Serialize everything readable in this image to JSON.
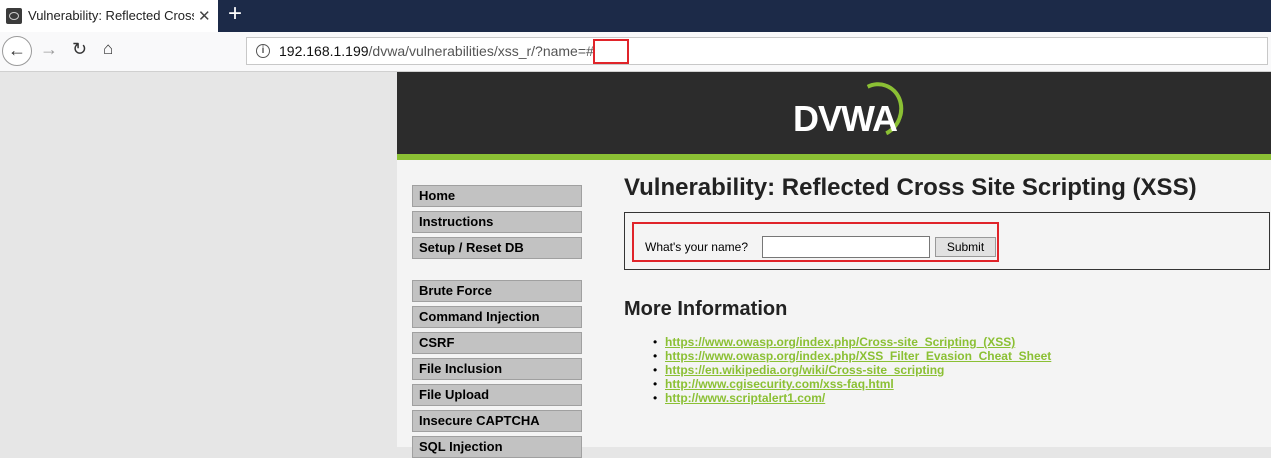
{
  "browser": {
    "tab_title": "Vulnerability: Reflected Cross Site Scripting (XSS)",
    "tab_close": "✕",
    "new_tab": "+",
    "back_icon": "←",
    "forward_icon": "→",
    "reload_icon": "↻",
    "home_icon": "⌂",
    "info_icon": "i",
    "url_host": "192.168.1.199",
    "url_path": "/dvwa/vulnerabilities/xss_r/?name=#"
  },
  "header": {
    "logo_text": "DVWA"
  },
  "menu": {
    "items": [
      "Home",
      "Instructions",
      "Setup / Reset DB",
      "Brute Force",
      "Command Injection",
      "CSRF",
      "File Inclusion",
      "File Upload",
      "Insecure CAPTCHA",
      "SQL Injection"
    ]
  },
  "main": {
    "title": "Vulnerability: Reflected Cross Site Scripting (XSS)",
    "form": {
      "label": "What's your name?",
      "input_value": "",
      "submit_label": "Submit"
    },
    "more_info_title": "More Information",
    "links": [
      "https://www.owasp.org/index.php/Cross-site_Scripting_(XSS)",
      "https://www.owasp.org/index.php/XSS_Filter_Evasion_Cheat_Sheet",
      "https://en.wikipedia.org/wiki/Cross-site_scripting",
      "http://www.cgisecurity.com/xss-faq.html",
      "http://www.scriptalert1.com/"
    ]
  },
  "colors": {
    "accent_green": "#8bc034",
    "header_dark": "#2c2c2c",
    "highlight_red": "#e0242a"
  }
}
